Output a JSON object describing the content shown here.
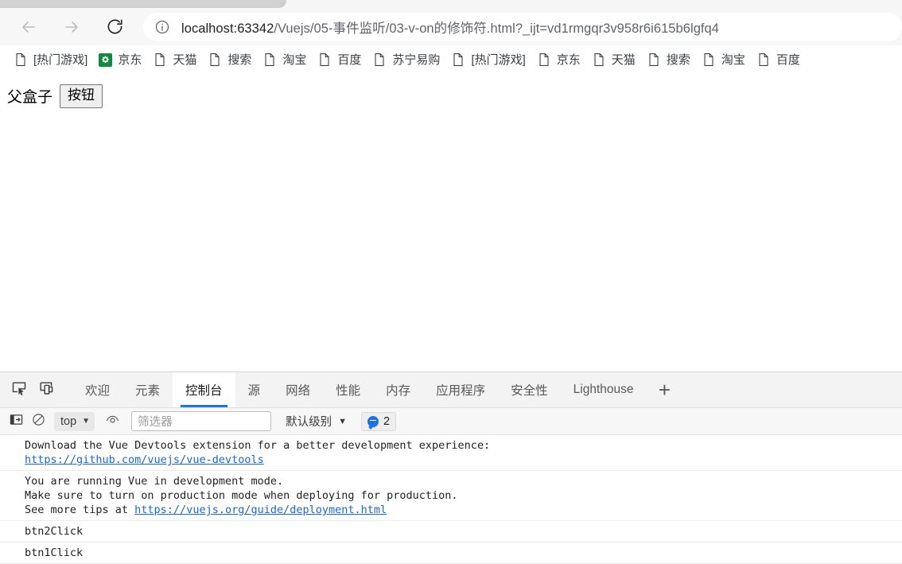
{
  "browser": {
    "nav": {
      "back_label": "Back",
      "forward_label": "Forward",
      "reload_label": "Reload"
    },
    "omnibox": {
      "info_icon": "info-circle-icon",
      "url_host": "localhost:63342",
      "url_path": "/Vuejs/05-事件监听/03-v-on的修饰符.html?_ijt=vd1rmgqr3v958r6i615b6lgfq4",
      "url_full": "localhost:63342/Vuejs/05-事件监听/03-v-on的修饰符.html?_ijt=vd1rmgqr3v958r6i615b6lgfq4"
    },
    "bookmarks": [
      {
        "label": "[热门游戏]",
        "icon": "page-icon"
      },
      {
        "label": "京东",
        "icon": "jd-logo-icon"
      },
      {
        "label": "天猫",
        "icon": "page-icon"
      },
      {
        "label": "搜索",
        "icon": "page-icon"
      },
      {
        "label": "淘宝",
        "icon": "page-icon"
      },
      {
        "label": "百度",
        "icon": "page-icon"
      },
      {
        "label": "苏宁易购",
        "icon": "page-icon"
      },
      {
        "label": "[热门游戏]",
        "icon": "page-icon"
      },
      {
        "label": "京东",
        "icon": "page-icon"
      },
      {
        "label": "天猫",
        "icon": "page-icon"
      },
      {
        "label": "搜索",
        "icon": "page-icon"
      },
      {
        "label": "淘宝",
        "icon": "page-icon"
      },
      {
        "label": "百度",
        "icon": "page-icon"
      }
    ]
  },
  "page": {
    "parent_box_text": "父盒子",
    "button_label": "按钮"
  },
  "devtools": {
    "left_icons": [
      {
        "name": "inspect-element-icon"
      },
      {
        "name": "device-toolbar-icon"
      }
    ],
    "tabs": [
      {
        "label": "欢迎",
        "active": false
      },
      {
        "label": "元素",
        "active": false
      },
      {
        "label": "控制台",
        "active": true
      },
      {
        "label": "源",
        "active": false
      },
      {
        "label": "网络",
        "active": false
      },
      {
        "label": "性能",
        "active": false
      },
      {
        "label": "内存",
        "active": false
      },
      {
        "label": "应用程序",
        "active": false
      },
      {
        "label": "安全性",
        "active": false
      },
      {
        "label": "Lighthouse",
        "active": false
      }
    ],
    "add_tab_label": "+",
    "console_toolbar": {
      "sidebar_toggle_icon": "console-sidebar-icon",
      "clear_console_icon": "clear-console-icon",
      "context_label": "top",
      "context_caret": "▼",
      "eye_icon": "live-expression-icon",
      "filter_placeholder": "筛选器",
      "filter_value": "",
      "level_label": "默认级别",
      "level_caret": "▼",
      "message_count": "2",
      "message_icon": "message-bubble-icon"
    },
    "console_messages": [
      {
        "lines": [
          {
            "text": "Download the Vue Devtools extension for a better development experience:",
            "link": false
          },
          {
            "text": "https://github.com/vuejs/vue-devtools",
            "link": true
          }
        ]
      },
      {
        "lines": [
          {
            "text": "You are running Vue in development mode.",
            "link": false
          },
          {
            "text": "Make sure to turn on production mode when deploying for production.",
            "link": false
          },
          {
            "text": "See more tips at ",
            "link": false,
            "suffix_link": "https://vuejs.org/guide/deployment.html"
          }
        ]
      },
      {
        "lines": [
          {
            "text": "btn2Click",
            "link": false
          }
        ]
      },
      {
        "lines": [
          {
            "text": "btn1Click",
            "link": false
          }
        ]
      }
    ]
  },
  "colors": {
    "accent_blue": "#1a73e8",
    "link_blue": "#1967d2",
    "jd_green": "#0f8a3e",
    "toolbar_bg": "#f7f7f7",
    "devtools_bg": "#f3f3f3"
  }
}
